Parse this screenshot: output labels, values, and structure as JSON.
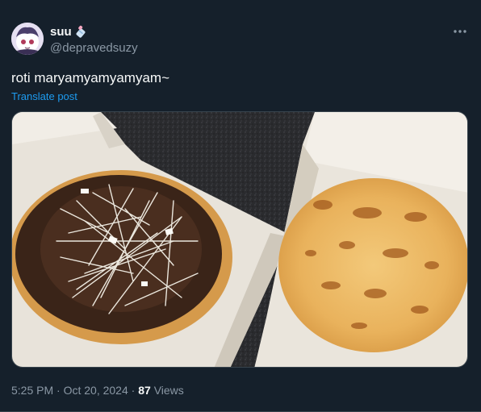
{
  "author": {
    "display_name": "suu",
    "handle": "@depravedsuzy",
    "avatar_icon": "anime-avatar",
    "name_emoji_icon": "baby-bottle-icon"
  },
  "tweet": {
    "text": "roti maryamyamyamyam~",
    "translate_label": "Translate post",
    "media_description_icon": "food-photo"
  },
  "meta": {
    "time": "5:25 PM",
    "separator": "·",
    "date": "Oct 20, 2024",
    "views_count": "87",
    "views_label": "Views"
  },
  "colors": {
    "background": "#15202b",
    "link": "#1d9bf0",
    "secondary_text": "#8b98a5"
  }
}
